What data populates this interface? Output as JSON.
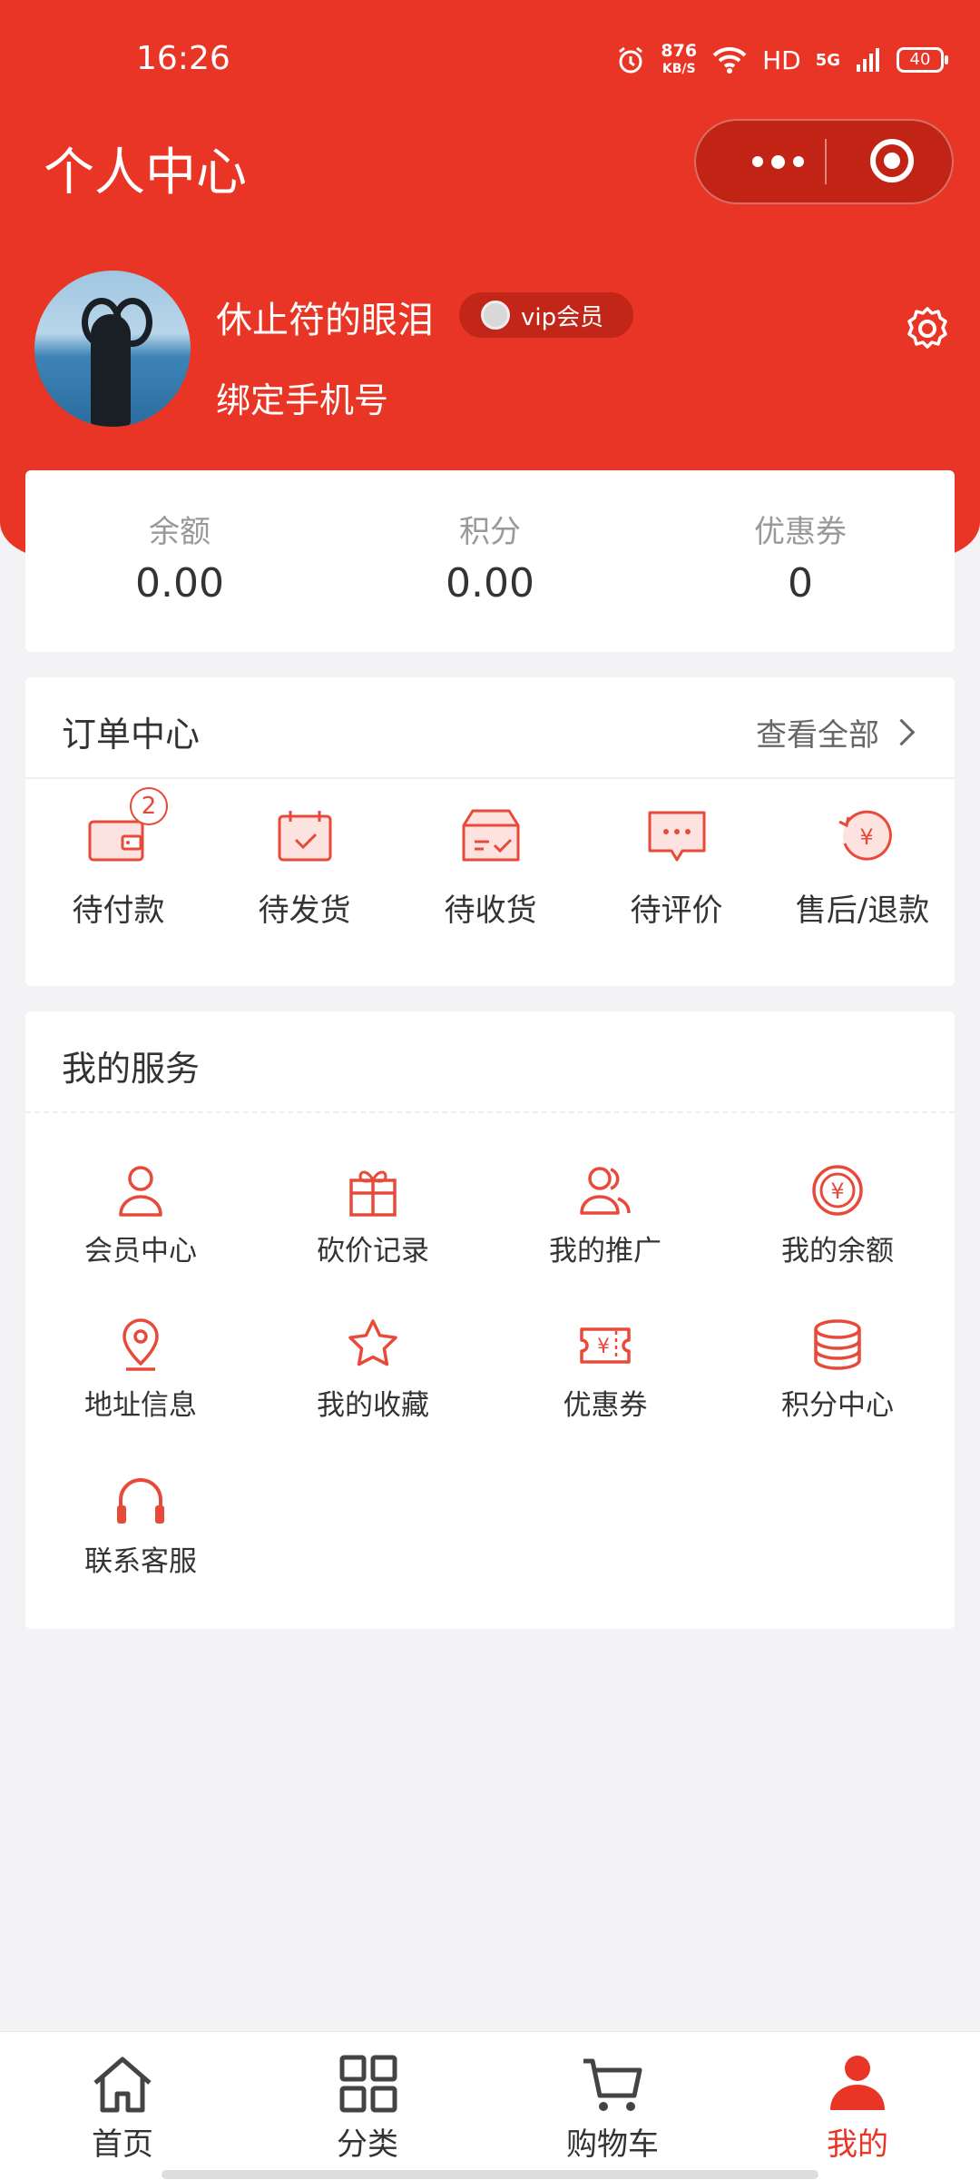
{
  "status_bar": {
    "time": "16:26",
    "net_speed_value": "876",
    "net_speed_unit": "KB/S",
    "hd": "HD",
    "network": "5G",
    "battery": "40"
  },
  "header": {
    "title": "个人中心"
  },
  "profile": {
    "username": "休止符的眼泪",
    "vip_label": "vip会员",
    "bind_phone": "绑定手机号"
  },
  "stats": [
    {
      "label": "余额",
      "value": "0.00"
    },
    {
      "label": "积分",
      "value": "0.00"
    },
    {
      "label": "优惠券",
      "value": "0"
    }
  ],
  "orders": {
    "title": "订单中心",
    "view_all": "查看全部",
    "items": [
      {
        "label": "待付款",
        "icon": "wallet-icon",
        "badge": "2"
      },
      {
        "label": "待发货",
        "icon": "calendar-check-icon"
      },
      {
        "label": "待收货",
        "icon": "box-check-icon"
      },
      {
        "label": "待评价",
        "icon": "chat-bubble-icon"
      },
      {
        "label": "售后/退款",
        "icon": "refund-yen-icon"
      }
    ]
  },
  "services": {
    "title": "我的服务",
    "items": [
      {
        "label": "会员中心",
        "icon": "user-icon"
      },
      {
        "label": "砍价记录",
        "icon": "gift-icon"
      },
      {
        "label": "我的推广",
        "icon": "users-icon"
      },
      {
        "label": "我的余额",
        "icon": "yen-coin-icon"
      },
      {
        "label": "地址信息",
        "icon": "location-pin-icon"
      },
      {
        "label": "我的收藏",
        "icon": "star-icon"
      },
      {
        "label": "优惠券",
        "icon": "ticket-icon"
      },
      {
        "label": "积分中心",
        "icon": "coin-stack-icon"
      },
      {
        "label": "联系客服",
        "icon": "headset-icon"
      }
    ]
  },
  "tabbar": [
    {
      "label": "首页",
      "icon": "home-icon"
    },
    {
      "label": "分类",
      "icon": "grid-icon"
    },
    {
      "label": "购物车",
      "icon": "cart-icon"
    },
    {
      "label": "我的",
      "icon": "user-filled-icon",
      "active": true
    }
  ],
  "colors": {
    "primary": "#e93525",
    "icon_red": "#e84a3a",
    "background": "#f3f3f5"
  }
}
